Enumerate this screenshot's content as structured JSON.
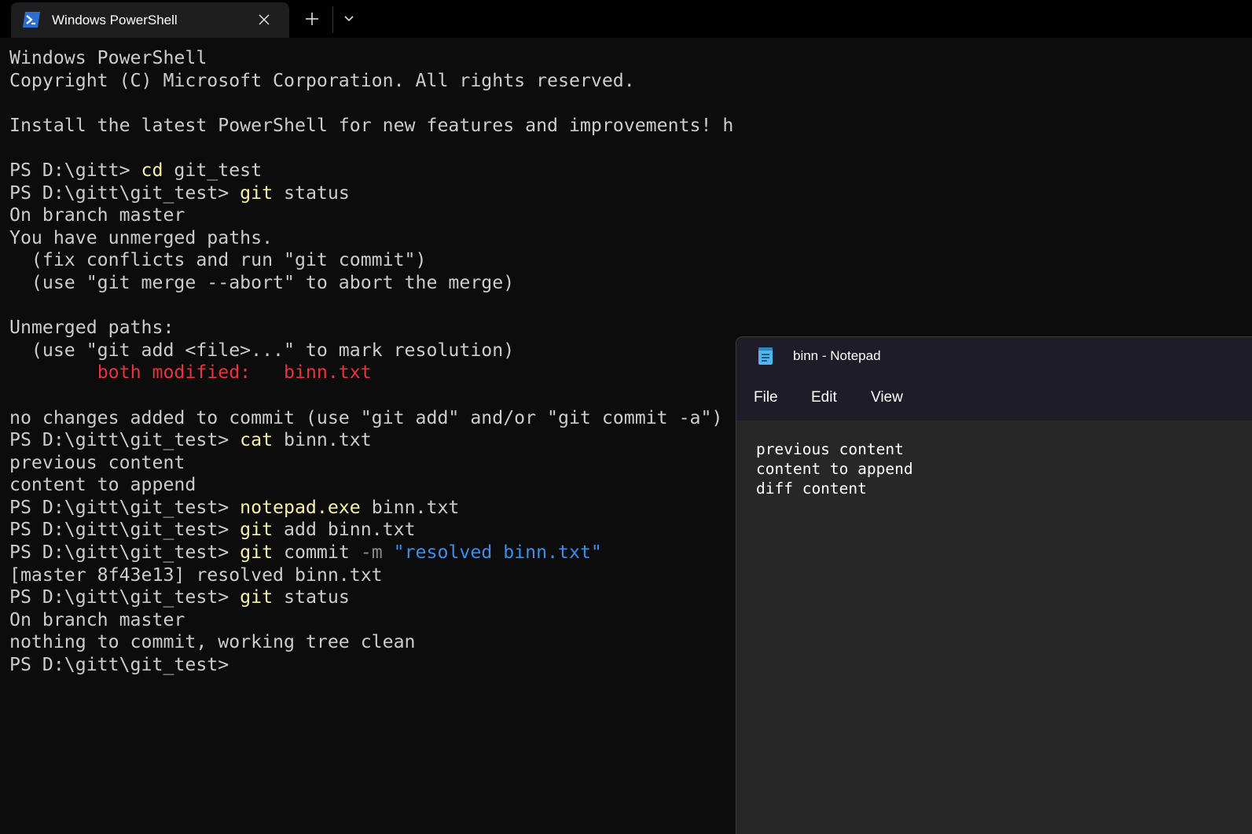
{
  "tab": {
    "title": "Windows PowerShell"
  },
  "icons": {
    "powershell": "powershell-icon",
    "close": "close-icon",
    "new_tab": "plus-icon",
    "dropdown": "chevron-down-icon",
    "notepad": "notepad-icon"
  },
  "colors": {
    "prompt_text": "#cccccc",
    "command": "#f9f1a5",
    "error": "#e8323e",
    "string": "#3b8eea",
    "param": "#8a8a8a"
  },
  "terminal": {
    "lines": [
      [
        {
          "t": "Windows PowerShell"
        }
      ],
      [
        {
          "t": "Copyright (C) Microsoft Corporation. All rights reserved."
        }
      ],
      [
        {
          "t": ""
        }
      ],
      [
        {
          "t": "Install the latest PowerShell for new features and improvements! https://aka.ms/PSWindows"
        }
      ],
      [
        {
          "t": ""
        }
      ],
      [
        {
          "t": "PS D:\\gitt> "
        },
        {
          "t": "cd",
          "c": "yellow"
        },
        {
          "t": " git_test"
        }
      ],
      [
        {
          "t": "PS D:\\gitt\\git_test> "
        },
        {
          "t": "git",
          "c": "yellow"
        },
        {
          "t": " status"
        }
      ],
      [
        {
          "t": "On branch master"
        }
      ],
      [
        {
          "t": "You have unmerged paths."
        }
      ],
      [
        {
          "t": "  (fix conflicts and run \"git commit\")"
        }
      ],
      [
        {
          "t": "  (use \"git merge --abort\" to abort the merge)"
        }
      ],
      [
        {
          "t": ""
        }
      ],
      [
        {
          "t": "Unmerged paths:"
        }
      ],
      [
        {
          "t": "  (use \"git add <file>...\" to mark resolution)"
        }
      ],
      [
        {
          "t": "        "
        },
        {
          "t": "both modified:   binn.txt",
          "c": "red"
        }
      ],
      [
        {
          "t": ""
        }
      ],
      [
        {
          "t": "no changes added to commit (use \"git add\" and/or \"git commit -a\")"
        }
      ],
      [
        {
          "t": "PS D:\\gitt\\git_test> "
        },
        {
          "t": "cat",
          "c": "yellow"
        },
        {
          "t": " binn.txt"
        }
      ],
      [
        {
          "t": "previous content"
        }
      ],
      [
        {
          "t": "content to append"
        }
      ],
      [
        {
          "t": "PS D:\\gitt\\git_test> "
        },
        {
          "t": "notepad.exe",
          "c": "yellow"
        },
        {
          "t": " binn.txt"
        }
      ],
      [
        {
          "t": "PS D:\\gitt\\git_test> "
        },
        {
          "t": "git",
          "c": "yellow"
        },
        {
          "t": " add binn.txt"
        }
      ],
      [
        {
          "t": "PS D:\\gitt\\git_test> "
        },
        {
          "t": "git",
          "c": "yellow"
        },
        {
          "t": " commit "
        },
        {
          "t": "-m",
          "c": "gray"
        },
        {
          "t": " "
        },
        {
          "t": "\"resolved binn.txt\"",
          "c": "blue"
        }
      ],
      [
        {
          "t": "[master 8f43e13] resolved binn.txt"
        }
      ],
      [
        {
          "t": "PS D:\\gitt\\git_test> "
        },
        {
          "t": "git",
          "c": "yellow"
        },
        {
          "t": " status"
        }
      ],
      [
        {
          "t": "On branch master"
        }
      ],
      [
        {
          "t": "nothing to commit, working tree clean"
        }
      ],
      [
        {
          "t": "PS D:\\gitt\\git_test> "
        }
      ]
    ]
  },
  "notepad": {
    "title": "binn - Notepad",
    "menu": [
      "File",
      "Edit",
      "View"
    ],
    "content": "previous content\ncontent to append\ndiff content"
  }
}
